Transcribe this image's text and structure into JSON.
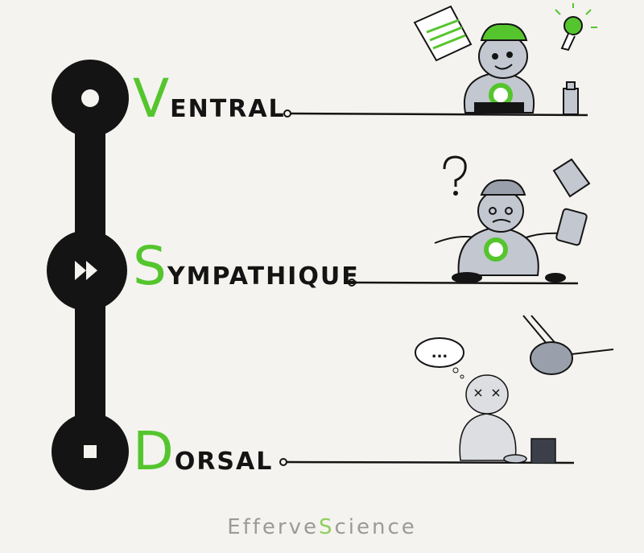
{
  "colors": {
    "ink": "#141414",
    "accent_green": "#55c52e",
    "figure_gray": "#c3c7d0",
    "paper": "#f4f3ef",
    "signature_gray": "#9a9a9a"
  },
  "levels": [
    {
      "initial": "V",
      "rest": "entral",
      "control_icon": "play-circle-icon"
    },
    {
      "initial": "S",
      "rest": "ympathique",
      "control_icon": "fast-forward-icon"
    },
    {
      "initial": "D",
      "rest": "orsal",
      "control_icon": "stop-icon"
    }
  ],
  "drawings": {
    "top": {
      "doodles": [
        "calendar-icon",
        "lightbulb-icon",
        "water-bottle-icon"
      ],
      "mood": "calm-smiling"
    },
    "middle": {
      "doodles": [
        "question-mark-icon",
        "note-paper-icon",
        "phone-icon"
      ],
      "mood": "stressed"
    },
    "bottom": {
      "doodles": [
        "thought-bubble-icon",
        "winged-brain-icon"
      ],
      "thought_bubble_text": "...",
      "mood": "shutdown"
    }
  },
  "signature": {
    "part1": "Efferve",
    "accent": "S",
    "part2": "cience"
  }
}
